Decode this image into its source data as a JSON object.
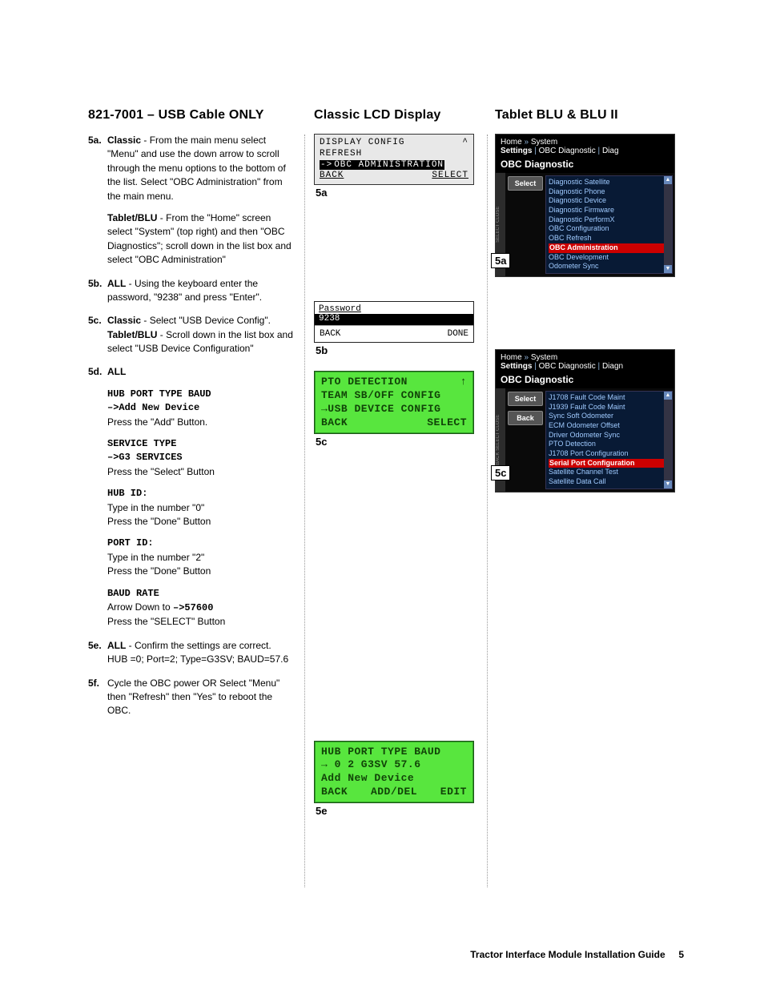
{
  "left": {
    "title": "821-7001 – USB Cable ONLY",
    "s5a": {
      "tag": "5a.",
      "classicLabel": "Classic",
      "classicText": " - From the main menu select \"Menu\" and use the down arrow to scroll through the menu options to the bottom of the list. Select \"OBC Administration\" from the main menu.",
      "tabletLabel": "Tablet/BLU",
      "tabletText": " - From the \"Home\" screen select \"System\" (top right) and then \"OBC Diagnostics\"; scroll down in the list box and select \"OBC Administration\""
    },
    "s5b": {
      "tag": "5b.",
      "lead": "ALL",
      "text": " - Using the keyboard enter the password, \"9238\" and press \"Enter\"."
    },
    "s5c": {
      "tag": "5c.",
      "classicLabel": "Classic",
      "classicText": " - Select \"USB Device Config\".",
      "tabletLabel": "Tablet/BLU",
      "tabletText": " - Scroll down in the list box and select \"USB Device Configuration\""
    },
    "s5d": {
      "tag": "5d.",
      "lead": "ALL",
      "b1_l1": "HUB PORT TYPE BAUD",
      "b1_l2": "–>Add New Device",
      "b1_l3": "Press the \"Add\" Button.",
      "b2_l1": "SERVICE TYPE",
      "b2_l2": "–>G3 SERVICES",
      "b2_l3": "Press the \"Select\" Button",
      "b3_l1": "HUB ID:",
      "b3_l2": "Type in the number \"0\"",
      "b3_l3": "Press the \"Done\" Button",
      "b4_l1": "PORT ID:",
      "b4_l2": "Type in the number \"2\"",
      "b4_l3": "Press the \"Done\" Button",
      "b5_l1": "BAUD RATE",
      "b5_l2a": "Arrow Down to ",
      "b5_l2b": "–>57600",
      "b5_l3": "Press the \"SELECT\" Button"
    },
    "s5e": {
      "tag": "5e.",
      "lead": "ALL",
      "text": " - Confirm the settings are correct. HUB =0; Port=2; Type=G3SV; BAUD=57.6"
    },
    "s5f": {
      "tag": "5f.",
      "text": "Cycle the OBC power OR Select \"Menu\" then \"Refresh\" then \"Yes\" to reboot the OBC."
    }
  },
  "mid": {
    "title": "Classic LCD Display",
    "lcd5a": {
      "l1": "DISPLAY CONFIG",
      "l2": "REFRESH",
      "l3a": "->",
      "l3b": "OBC ADMINISTRATION",
      "l4a": "BACK",
      "l4b": "SELECT",
      "cap": "5a"
    },
    "lcd5b": {
      "top": "Password",
      "val": "9238",
      "bL": "BACK",
      "bR": "DONE",
      "cap": "5b"
    },
    "lcd5c": {
      "l1": "PTO DETECTION",
      "l2": "TEAM SB/OFF CONFIG",
      "l3": "→USB DEVICE CONFIG",
      "l4a": "BACK",
      "l4b": "SELECT",
      "cap": "5c"
    },
    "lcd5e": {
      "l1": "HUB PORT TYPE BAUD",
      "l2": "→ 0   2  G3SV 57.6",
      "l3": "Add New Device",
      "l4a": "BACK",
      "l4b": "ADD/DEL",
      "l4c": "EDIT",
      "cap": "5e"
    }
  },
  "right": {
    "title": "Tablet BLU & BLU II",
    "shot5a": {
      "crumb1": "Home",
      "crumb2": "System",
      "crumb3a": "Settings",
      "crumb3b": "OBC Diagnostic",
      "crumb3c": "Diag",
      "subtitle": "OBC Diagnostic",
      "btn": "Select",
      "items": [
        "Diagnostic Satellite",
        "Diagnostic Phone",
        "Diagnostic Device",
        "Diagnostic Firmware",
        "Diagnostic PerformX",
        "OBC Configuration",
        "OBC Refresh"
      ],
      "sel": "OBC Administration",
      "after": [
        "OBC Development",
        "Odometer Sync"
      ],
      "callout": "5a"
    },
    "shot5c": {
      "crumb1": "Home",
      "crumb2": "System",
      "crumb3a": "Settings",
      "crumb3b": "OBC Diagnostic",
      "crumb3c": "Diagn",
      "subtitle": "OBC Diagnostic",
      "btn1": "Select",
      "btn2": "Back",
      "items": [
        "J1708 Fault Code Maint",
        "J1939 Fault Code Maint",
        "Sync Soft Odometer",
        "ECM Odometer Offset",
        "Driver Odometer Sync",
        "PTO Detection",
        "J1708 Port Configuration"
      ],
      "sel": "Serial Port Configuration",
      "after": [
        "Satellite Channel Test",
        "Satellite Data Call"
      ],
      "callout": "5c"
    }
  },
  "footer": {
    "title": "Tractor Interface Module Installation Guide",
    "page": "5"
  }
}
